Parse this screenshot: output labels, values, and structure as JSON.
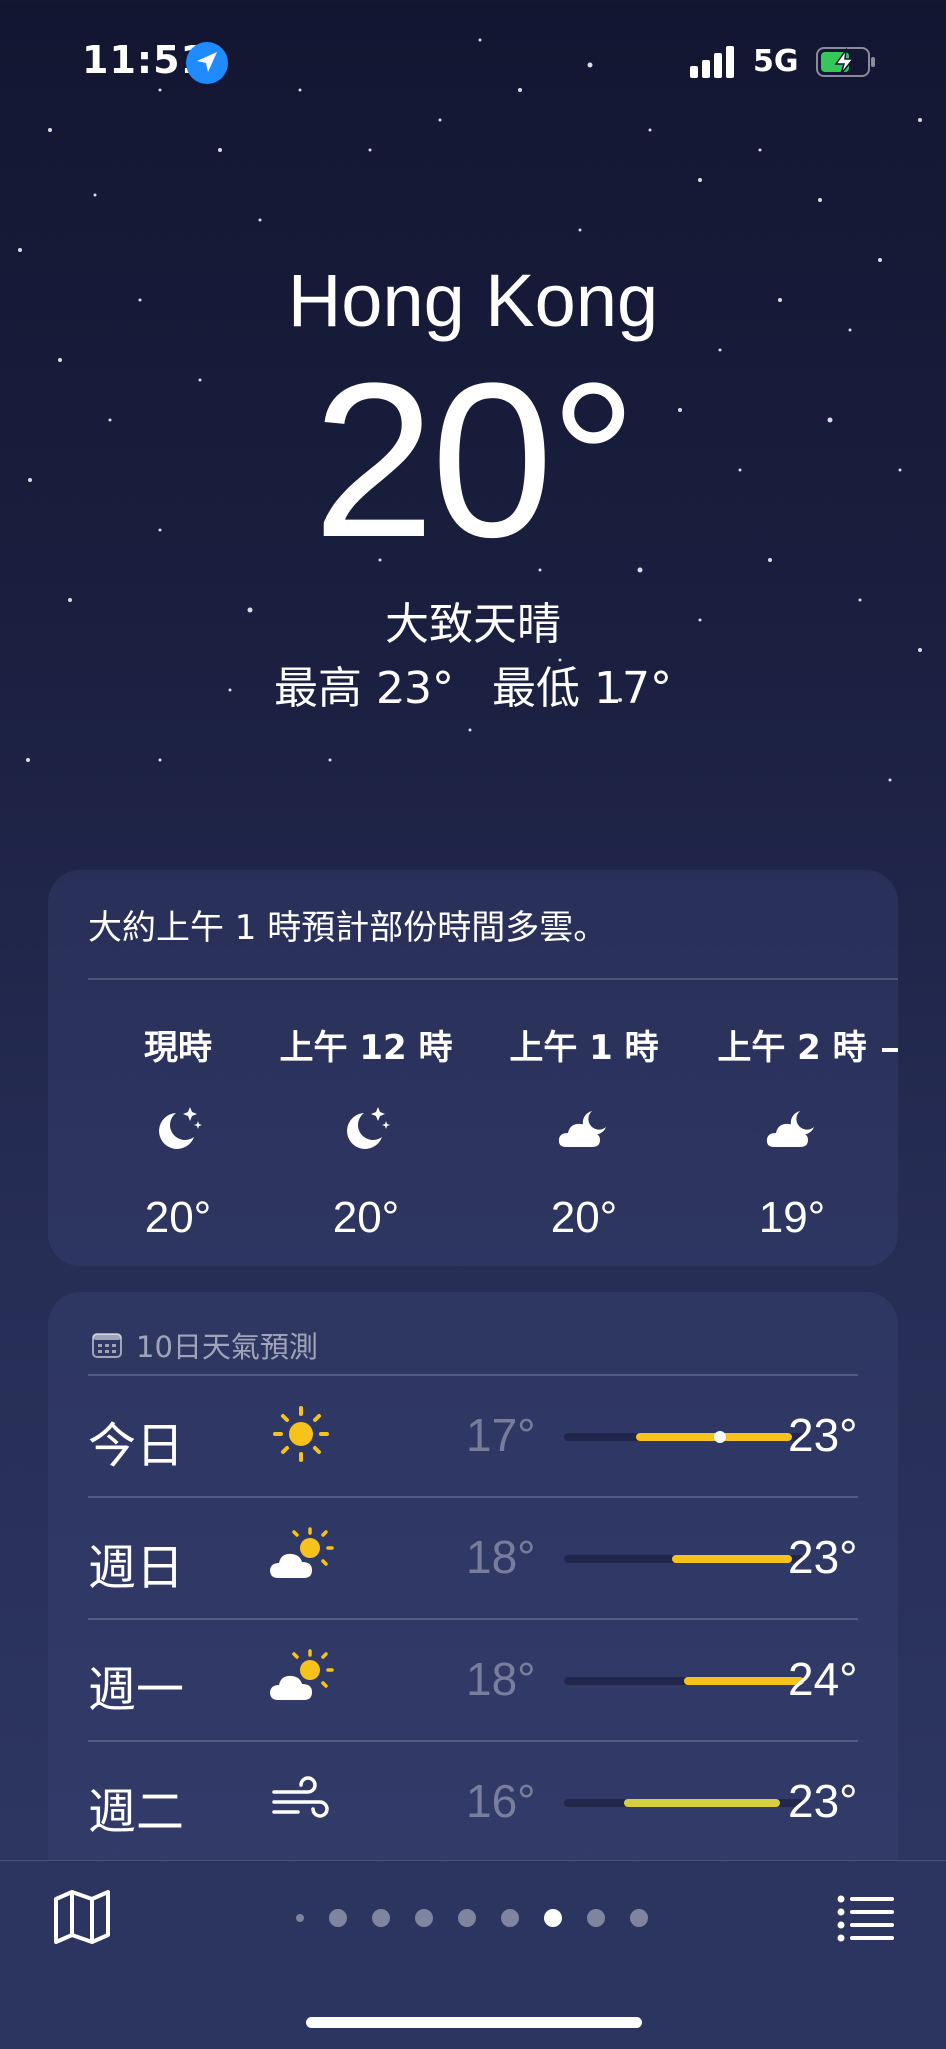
{
  "status_bar": {
    "time": "11:51",
    "network": "5G"
  },
  "location": {
    "city": "Hong Kong",
    "temperature": "20°",
    "condition": "大致天晴",
    "high": "最高 23°",
    "low": "最低 17°"
  },
  "hourly": {
    "summary": "大約上午 1 時預計部份時間多雲。",
    "items": [
      {
        "label": "現時",
        "icon": "moon-stars-icon",
        "temp": "20°"
      },
      {
        "label": "上午 12 時",
        "icon": "moon-stars-icon",
        "temp": "20°"
      },
      {
        "label": "上午 1 時",
        "icon": "cloud-moon-icon",
        "temp": "20°"
      },
      {
        "label": "上午 2 時",
        "icon": "cloud-moon-icon",
        "temp": "19°"
      }
    ]
  },
  "daily": {
    "header": "10日天氣預測",
    "days": [
      {
        "name": "今日",
        "icon": "sun-icon",
        "low": "17°",
        "high": "23°",
        "range": [
          0.3,
          0.95
        ],
        "current": 0.65,
        "color": "#f6c21c"
      },
      {
        "name": "週日",
        "icon": "cloud-sun-icon",
        "low": "18°",
        "high": "23°",
        "range": [
          0.45,
          0.95
        ],
        "color": "#f6c21c"
      },
      {
        "name": "週一",
        "icon": "cloud-sun-icon",
        "low": "18°",
        "high": "24°",
        "range": [
          0.5,
          1.0
        ],
        "color": "#f6c21c"
      },
      {
        "name": "週二",
        "icon": "wind-icon",
        "low": "16°",
        "high": "23°",
        "range": [
          0.25,
          0.9
        ],
        "color": "#d6d040"
      }
    ]
  },
  "toolbar": {
    "pages": 8,
    "active_page": 6
  },
  "colors": {
    "accent": "#1f8bff",
    "bar_yellow": "#f6c21c"
  }
}
